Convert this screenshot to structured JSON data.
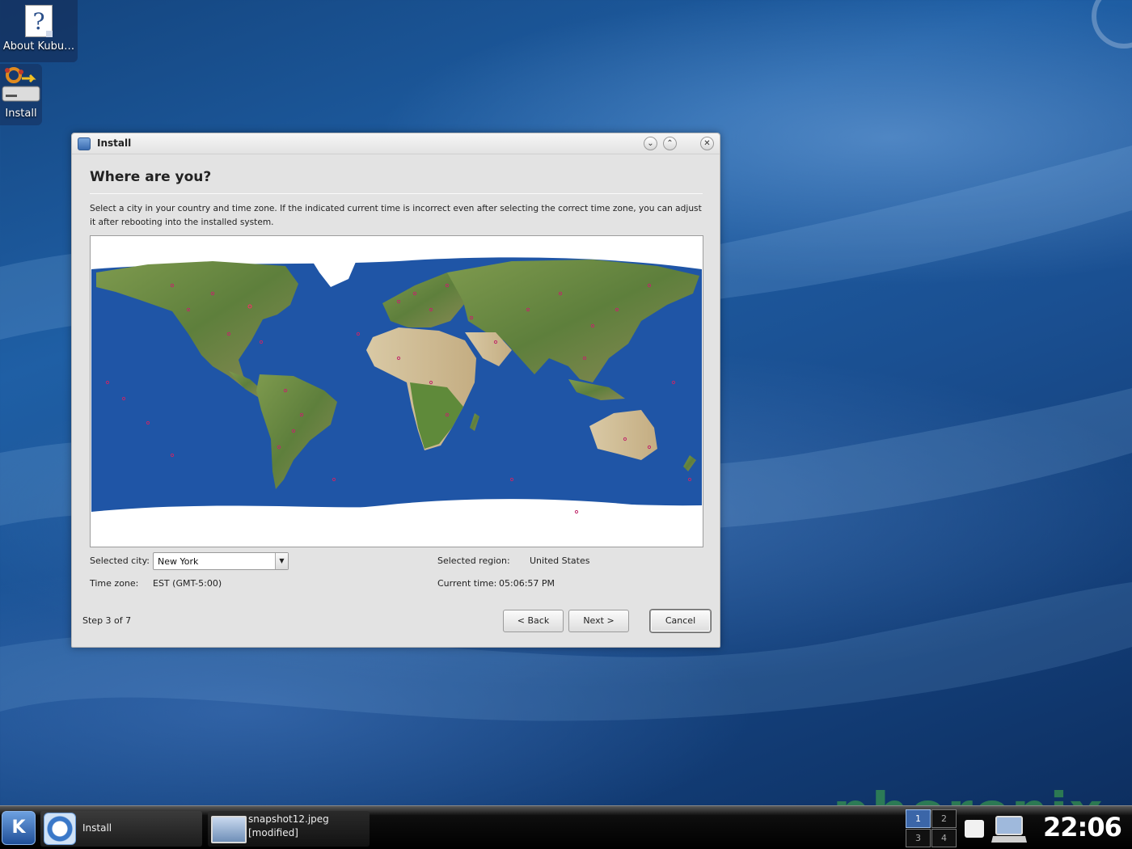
{
  "desktop": {
    "icons": [
      {
        "label": "About Kubu…",
        "icon": "help-document-icon"
      },
      {
        "label": "Install",
        "icon": "install-drive-icon"
      }
    ]
  },
  "window": {
    "title": "Install",
    "heading": "Where are you?",
    "description": "Select a city in your country and time zone. If the indicated current time is incorrect even after selecting the correct time zone, you can adjust it after rebooting into the installed system.",
    "selected_city_label": "Selected city:",
    "selected_city": "New York",
    "selected_region_label": "Selected region:",
    "selected_region": "United States",
    "time_zone_label": "Time zone:",
    "time_zone": "EST (GMT-5:00)",
    "current_time_label": "Current time:",
    "current_time": "05:06:57 PM",
    "step": "Step 3 of 7",
    "back_label": "< Back",
    "next_label": "Next >",
    "cancel_label": "Cancel"
  },
  "taskbar": {
    "tasks": [
      {
        "label": "Install"
      },
      {
        "label_line1": "snapshot12.jpeg",
        "label_line2": "[modified]"
      }
    ],
    "pager": [
      "1",
      "2",
      "3",
      "4"
    ],
    "active_desktop": "1",
    "clock": "22:06",
    "watermark": "phoronix"
  },
  "colors": {
    "ocean": "#1f55a6",
    "land": "#6f8f45",
    "ice": "#ffffff"
  }
}
